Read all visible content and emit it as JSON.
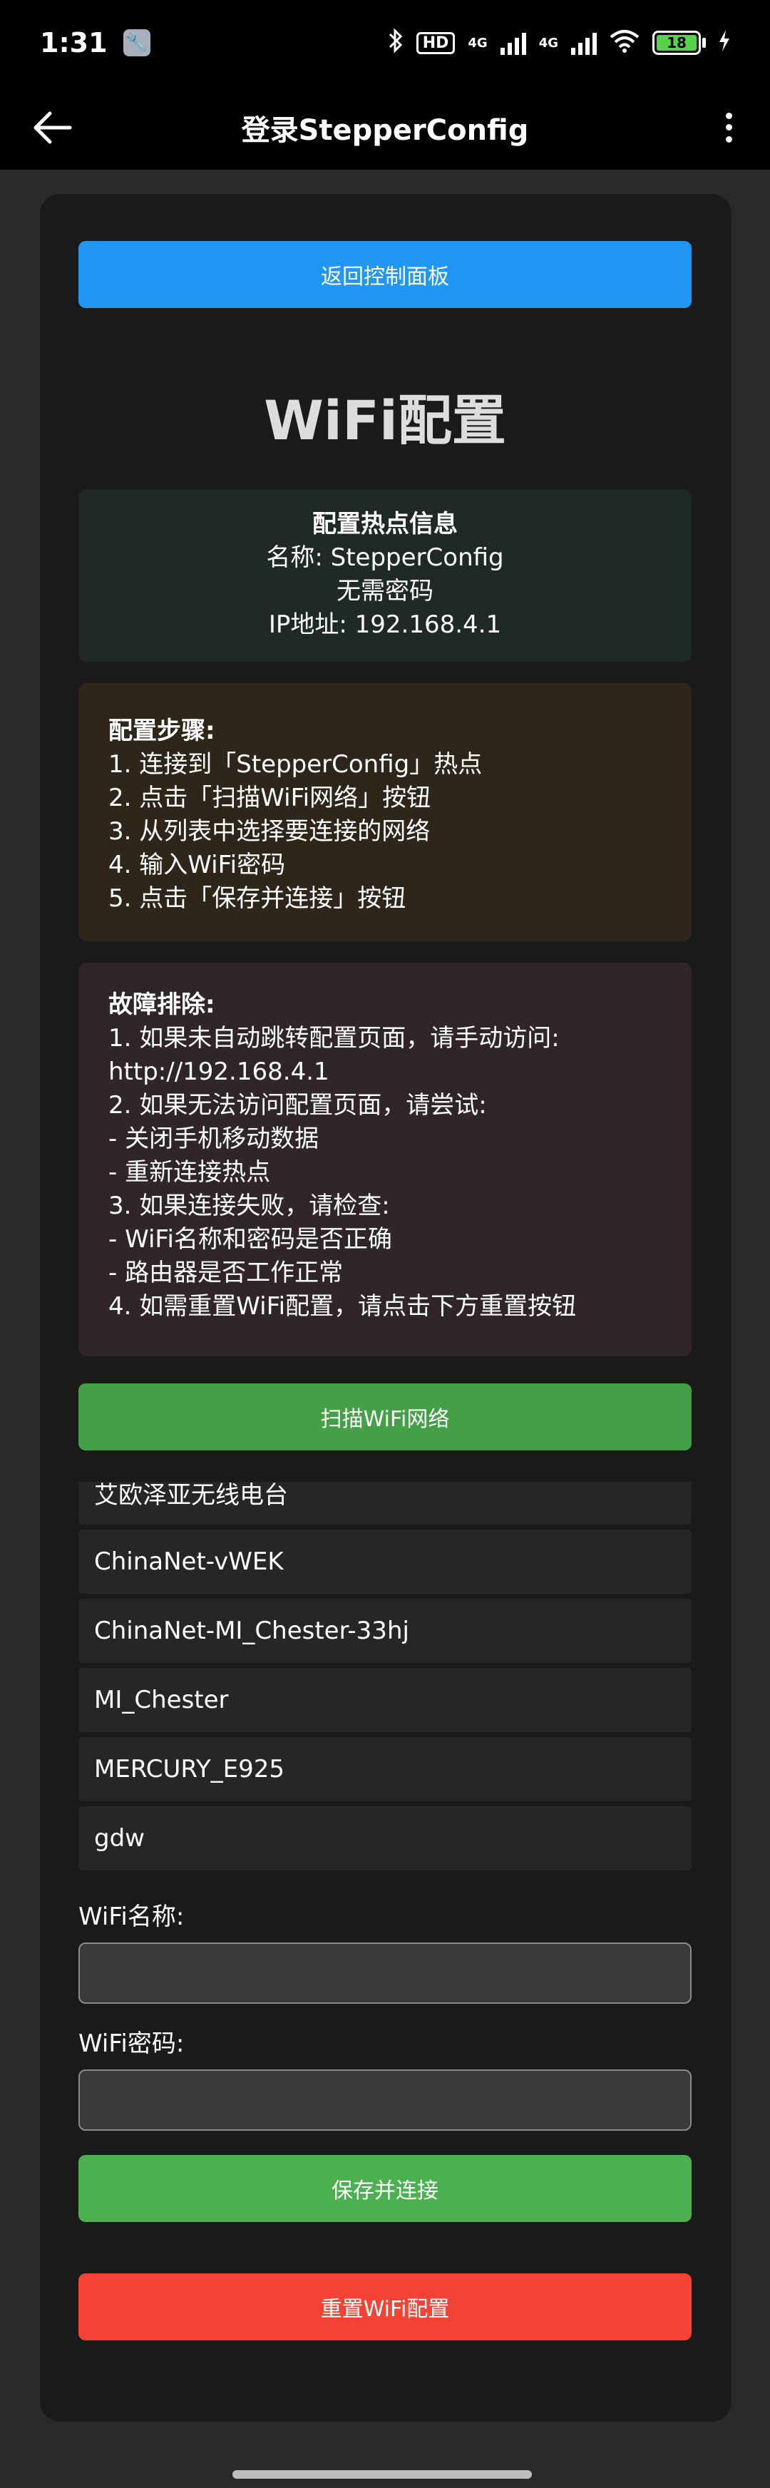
{
  "statusbar": {
    "time": "1:31",
    "hd": "HD",
    "net1": "4G",
    "net2": "4G",
    "battery": "18"
  },
  "appbar": {
    "title": "登录StepperConfig"
  },
  "buttons": {
    "back_to_panel": "返回控制面板",
    "scan": "扫描WiFi网络",
    "save": "保存并连接",
    "reset": "重置WiFi配置"
  },
  "heading": "WiFi配置",
  "hotspot_info": {
    "title": "配置热点信息",
    "name": "名称: StepperConfig",
    "password": "无需密码",
    "ip": "IP地址: 192.168.4.1"
  },
  "steps": {
    "title": "配置步骤:",
    "items": [
      "1. 连接到「StepperConfig」热点",
      "2. 点击「扫描WiFi网络」按钮",
      "3. 从列表中选择要连接的网络",
      "4. 输入WiFi密码",
      "5. 点击「保存并连接」按钮"
    ]
  },
  "troubleshoot": {
    "title": "故障排除:",
    "items": [
      "1. 如果未自动跳转配置页面，请手动访问:",
      "http://192.168.4.1",
      "2. 如果无法访问配置页面，请尝试:",
      "- 关闭手机移动数据",
      "- 重新连接热点",
      "3. 如果连接失败，请检查:",
      "- WiFi名称和密码是否正确",
      "- 路由器是否工作正常",
      "4. 如需重置WiFi配置，请点击下方重置按钮"
    ]
  },
  "networks": [
    "艾欧泽亚无线电台",
    "ChinaNet-vWEK",
    "ChinaNet-MI_Chester-33hj",
    "MI_Chester",
    "MERCURY_E925",
    "gdw"
  ],
  "form": {
    "ssid_label": "WiFi名称:",
    "ssid_value": "",
    "password_label": "WiFi密码:",
    "password_value": ""
  },
  "colors": {
    "primary_blue": "#2196f3",
    "success_green": "#4caf50",
    "danger_red": "#f44336"
  }
}
